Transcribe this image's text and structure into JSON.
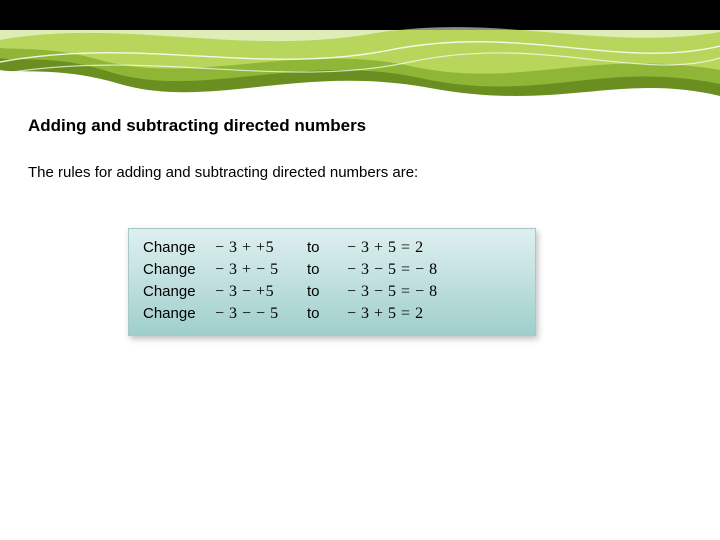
{
  "title": "Adding and subtracting directed numbers",
  "intro": "The rules for adding and subtracting directed numbers are:",
  "rules": [
    {
      "change": "Change",
      "left": "− 3 + +5",
      "to": "to",
      "right": "− 3 + 5 = 2"
    },
    {
      "change": "Change",
      "left": "− 3 + − 5",
      "to": "to",
      "right": "− 3 − 5 = − 8"
    },
    {
      "change": "Change",
      "left": "− 3 − +5",
      "to": "to",
      "right": "− 3 − 5 = − 8"
    },
    {
      "change": "Change",
      "left": "− 3 − − 5",
      "to": "to",
      "right": "− 3 + 5 = 2"
    }
  ],
  "chart_data": {
    "type": "table",
    "title": "Adding and subtracting directed numbers",
    "columns": [
      "action",
      "expression_before",
      "verb",
      "expression_after"
    ],
    "rows": [
      [
        "Change",
        "-3 + +5",
        "to",
        "-3 + 5 = 2"
      ],
      [
        "Change",
        "-3 + -5",
        "to",
        "-3 - 5 = -8"
      ],
      [
        "Change",
        "-3 - +5",
        "to",
        "-3 - 5 = -8"
      ],
      [
        "Change",
        "-3 - -5",
        "to",
        "-3 + 5 = 2"
      ]
    ]
  },
  "theme": {
    "banner_green_dark": "#5a7a1a",
    "banner_green_mid": "#8aae2f",
    "banner_green_light": "#b7d65b",
    "box_top": "#dfeff0",
    "box_bottom": "#9fcfca"
  }
}
